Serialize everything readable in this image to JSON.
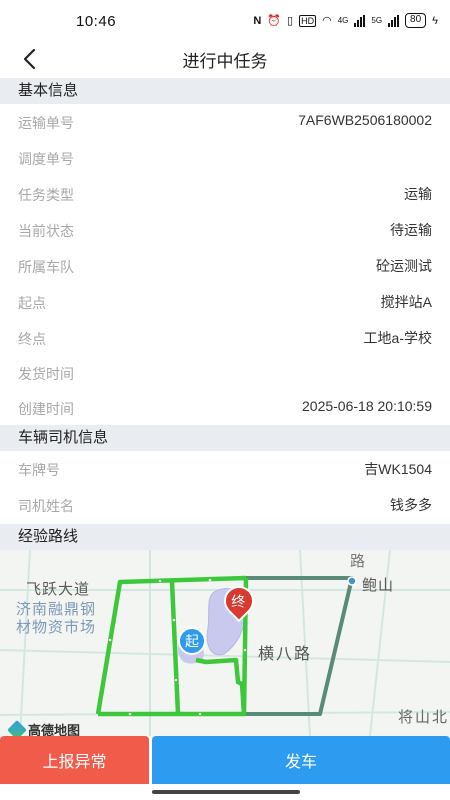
{
  "status_bar": {
    "time": "10:46",
    "nfc": "N",
    "network1": "HD",
    "network2": "4G",
    "network3": "5G",
    "battery": "80"
  },
  "nav": {
    "title": "进行中任务",
    "back_icon": "chevron-left-icon"
  },
  "sections": {
    "basic_info": "基本信息",
    "vehicle_driver": "车辆司机信息",
    "route": "经验路线"
  },
  "basic_info": [
    {
      "label": "运输单号",
      "value": "7AF6WB2506180002"
    },
    {
      "label": "调度单号",
      "value": ""
    },
    {
      "label": "任务类型",
      "value": "运输"
    },
    {
      "label": "当前状态",
      "value": "待运输"
    },
    {
      "label": "所属车队",
      "value": "砼运测试"
    },
    {
      "label": "起点",
      "value": "搅拌站A"
    },
    {
      "label": "终点",
      "value": "工地a-学校"
    },
    {
      "label": "发货时间",
      "value": ""
    },
    {
      "label": "创建时间",
      "value": "2025-06-18 20:10:59"
    }
  ],
  "vehicle_info": [
    {
      "label": "车牌号",
      "value": "吉WK1504"
    },
    {
      "label": "司机姓名",
      "value": "钱多多"
    }
  ],
  "map": {
    "road_feiyue": "飞跃大道",
    "poi_jinan_1": "济南融鼎钢",
    "poi_jinan_2": "材物资市场",
    "road_hengba": "横八路",
    "poi_baoshan": "鲍山",
    "road_lu": "路",
    "road_jiangshan": "将山北",
    "start_marker": "起",
    "end_marker": "终",
    "logo": "高德地图",
    "route_color": "#3cc83a",
    "route_alt_color": "#5a8a78"
  },
  "actions": {
    "report_label": "上报异常",
    "depart_label": "发车",
    "report_color": "#f05b4a",
    "depart_color": "#2d9bf0"
  }
}
